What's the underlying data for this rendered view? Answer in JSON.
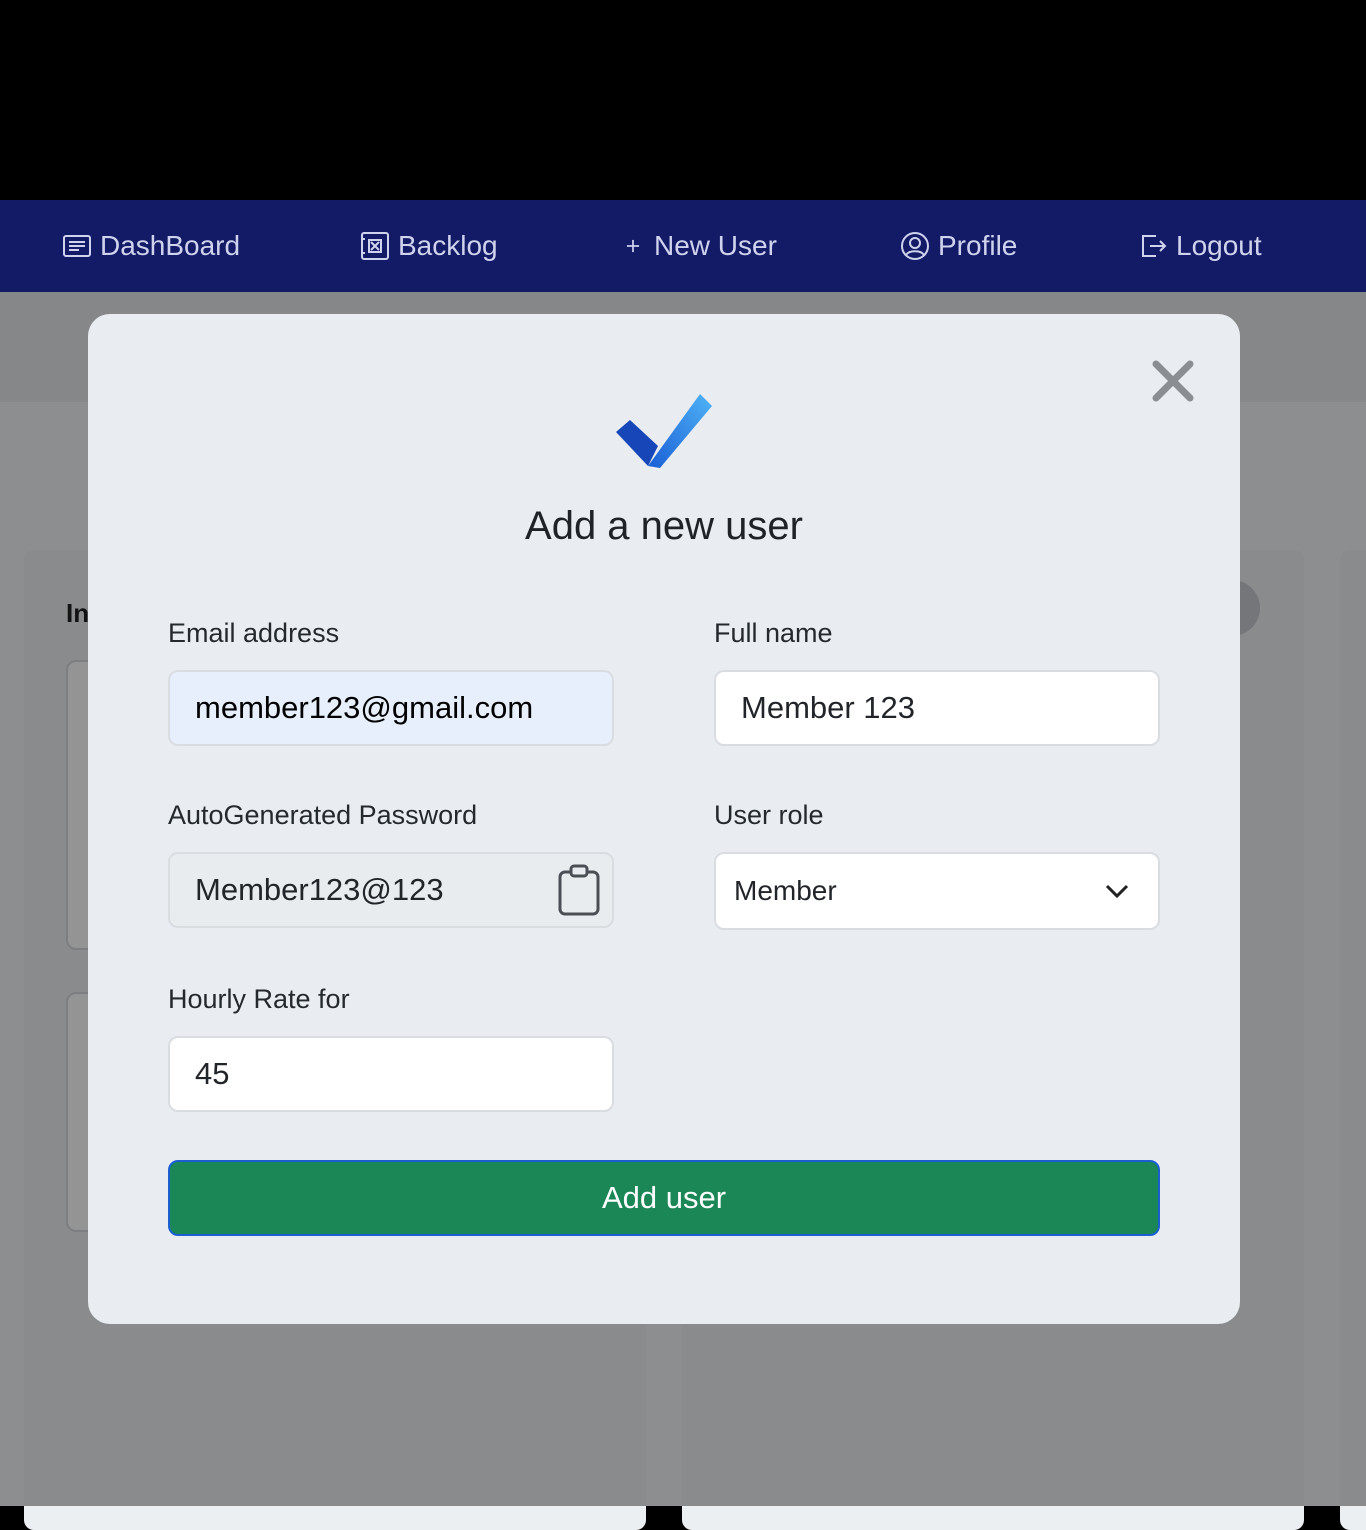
{
  "nav": {
    "items": [
      {
        "label": "DashBoard",
        "icon": "dashboard-icon"
      },
      {
        "label": "Backlog",
        "icon": "backlog-icon"
      },
      {
        "label": "New User",
        "icon": "plus-icon"
      },
      {
        "label": "Profile",
        "icon": "user-circle-icon"
      },
      {
        "label": "Logout",
        "icon": "logout-icon"
      }
    ]
  },
  "background": {
    "column_title": "In"
  },
  "modal": {
    "title": "Add a new user",
    "logo": "checkmark-logo-icon",
    "close": "close-icon",
    "email": {
      "label": "Email address",
      "value": "member123@gmail.com"
    },
    "full_name": {
      "label": "Full name",
      "value": "Member 123"
    },
    "password": {
      "label": "AutoGenerated Password",
      "value": "Member123@123",
      "icon": "clipboard-icon"
    },
    "role": {
      "label": "User role",
      "selected": "Member",
      "icon": "chevron-down-icon"
    },
    "hourly_rate": {
      "label": "Hourly Rate for",
      "value": "45"
    },
    "submit_label": "Add user"
  },
  "colors": {
    "navbar": "#141b66",
    "submit": "#1b8756",
    "modal_bg": "#e9edf1"
  }
}
